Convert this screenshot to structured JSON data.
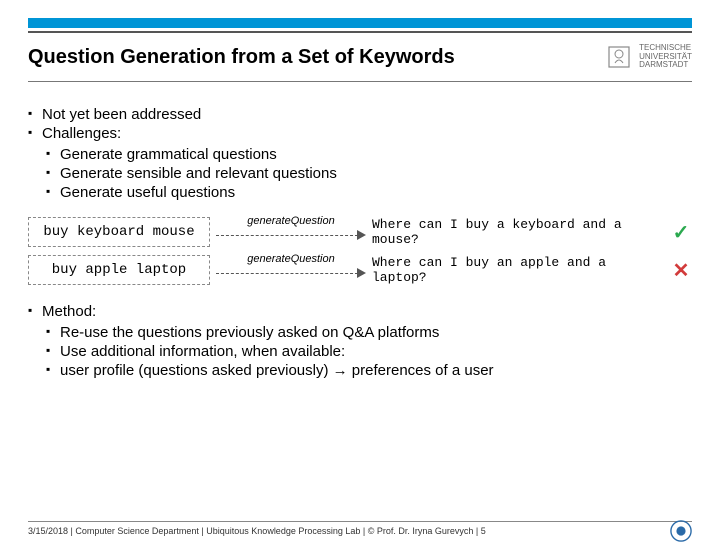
{
  "header": {
    "title": "Question Generation from a Set of Keywords",
    "university": {
      "line1": "TECHNISCHE",
      "line2": "UNIVERSITÄT",
      "line3": "DARMSTADT"
    }
  },
  "bullets": {
    "b1_1": "Not yet been addressed",
    "b1_2": "Challenges:",
    "b2_1": "Generate grammatical questions",
    "b2_2": "Generate sensible and relevant questions",
    "b2_3": "Generate useful questions"
  },
  "arrow_label": "generateQuestion",
  "examples": [
    {
      "keywords": "buy keyboard mouse",
      "output": "Where can I buy a keyboard and a mouse?",
      "ok": true
    },
    {
      "keywords": "buy apple laptop",
      "output": "Where can I buy an apple and a laptop?",
      "ok": false
    }
  ],
  "method": {
    "heading": "Method:",
    "m1": "Re-use the questions previously asked on Q&A platforms",
    "m2": "Use additional information, when available:",
    "m2_1": "user profile (questions asked previously) → preferences of a user"
  },
  "footer": {
    "text": "3/15/2018  |  Computer Science Department  |  Ubiquitous Knowledge Processing Lab  | © Prof. Dr. Iryna Gurevych  |  5"
  }
}
